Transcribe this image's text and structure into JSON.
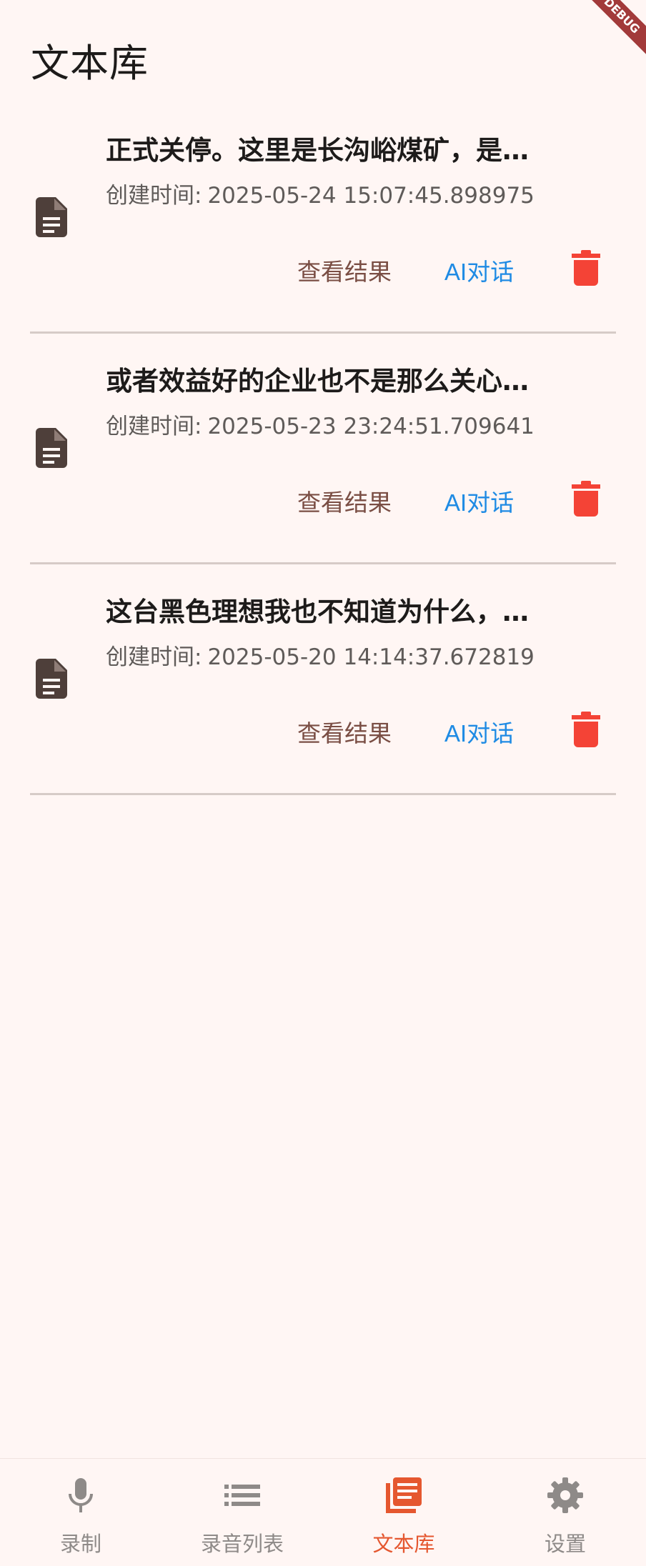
{
  "app": {
    "title": "文本库",
    "debug_banner": "DEBUG"
  },
  "colors": {
    "background": "#fff6f4",
    "view_button": "#7a4e44",
    "ai_button": "#1f8be4",
    "delete_icon": "#f44336",
    "active_tab": "#e5572f",
    "inactive_tab": "#8e8a88"
  },
  "documents": [
    {
      "title": "正式关停。这里是长沟峪煤矿，是…",
      "created_label": "创建时间:",
      "created_time": "2025-05-24 15:07:45.898975",
      "view_label": "查看结果",
      "ai_label": "AI对话",
      "icon": "document-icon",
      "delete_icon": "trash-icon"
    },
    {
      "title": "或者效益好的企业也不是那么关心…",
      "created_label": "创建时间:",
      "created_time": "2025-05-23 23:24:51.709641",
      "view_label": "查看结果",
      "ai_label": "AI对话",
      "icon": "document-icon",
      "delete_icon": "trash-icon"
    },
    {
      "title": "这台黑色理想我也不知道为什么，…",
      "created_label": "创建时间:",
      "created_time": "2025-05-20 14:14:37.672819",
      "view_label": "查看结果",
      "ai_label": "AI对话",
      "icon": "document-icon",
      "delete_icon": "trash-icon"
    }
  ],
  "bottom_nav": {
    "active_index": 2,
    "items": [
      {
        "label": "录制",
        "icon": "microphone-icon"
      },
      {
        "label": "录音列表",
        "icon": "list-icon"
      },
      {
        "label": "文本库",
        "icon": "library-icon"
      },
      {
        "label": "设置",
        "icon": "gear-icon"
      }
    ]
  }
}
